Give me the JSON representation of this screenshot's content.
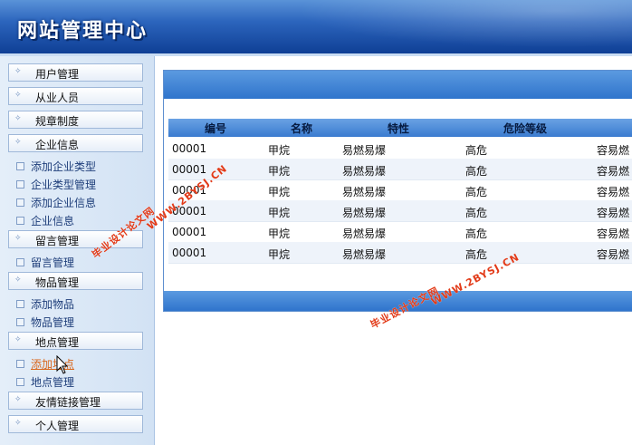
{
  "header": {
    "title": "网站管理中心"
  },
  "sidebar": {
    "menus": [
      {
        "label": "用户管理",
        "sub": []
      },
      {
        "label": "从业人员",
        "sub": []
      },
      {
        "label": "规章制度",
        "sub": []
      },
      {
        "label": "企业信息",
        "sub": [
          "添加企业类型",
          "企业类型管理",
          "添加企业信息",
          "企业信息"
        ]
      },
      {
        "label": "留言管理",
        "sub": [
          "留言管理"
        ]
      },
      {
        "label": "物品管理",
        "sub": [
          "添加物品",
          "物品管理"
        ]
      },
      {
        "label": "地点管理",
        "sub": [
          "添加地点",
          "地点管理"
        ]
      },
      {
        "label": "友情链接管理",
        "sub": []
      },
      {
        "label": "个人管理",
        "sub": []
      }
    ]
  },
  "table": {
    "columns": [
      "编号",
      "名称",
      "特性",
      "危险等级"
    ],
    "rows": [
      [
        "00001",
        "甲烷",
        "易燃易爆",
        "高危",
        "容易燃"
      ],
      [
        "00001",
        "甲烷",
        "易燃易爆",
        "高危",
        "容易燃"
      ],
      [
        "00001",
        "甲烷",
        "易燃易爆",
        "高危",
        "容易燃"
      ],
      [
        "00001",
        "甲烷",
        "易燃易爆",
        "高危",
        "容易燃"
      ],
      [
        "00001",
        "甲烷",
        "易燃易爆",
        "高危",
        "容易燃"
      ],
      [
        "00001",
        "甲烷",
        "易燃易爆",
        "高危",
        "容易燃"
      ]
    ]
  },
  "watermarks": [
    {
      "line1": "毕业设计论文网",
      "line2": "WWW.2BYSJ.CN"
    },
    {
      "line1": "毕业设计论文网",
      "line2": "WWW.2BYSJ.CN"
    }
  ],
  "colors": {
    "header": "#1a4ea8",
    "accent": "#3a7bd0",
    "active_link": "#d9661a",
    "watermark": "#e23a18"
  }
}
